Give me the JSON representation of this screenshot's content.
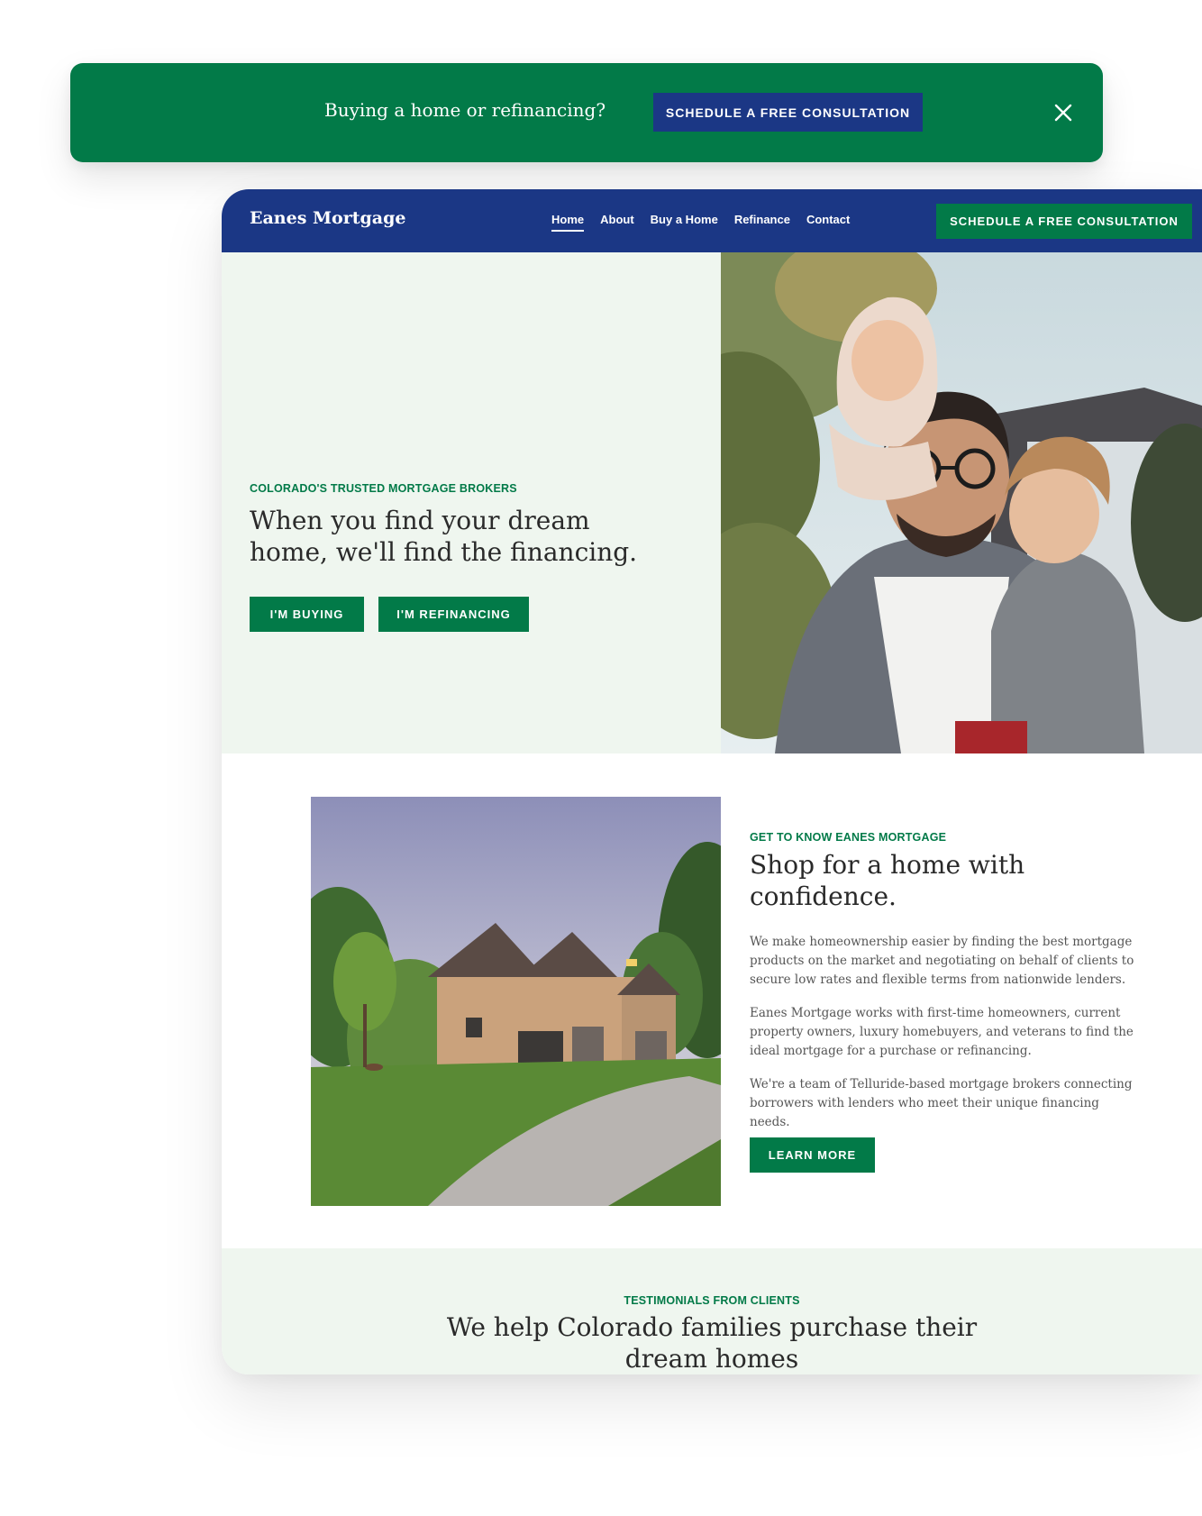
{
  "banner": {
    "text": "Buying a home or refinancing?",
    "button_label": "SCHEDULE A FREE CONSULTATION",
    "close_icon": "close-icon"
  },
  "nav": {
    "logo": "Eanes Mortgage",
    "links": [
      "Home",
      "About",
      "Buy a Home",
      "Refinance",
      "Contact"
    ],
    "active_link": "Home",
    "cta_label": "SCHEDULE A FREE CONSULTATION"
  },
  "hero": {
    "eyebrow": "COLORADO'S TRUSTED MORTGAGE BROKERS",
    "title": "When you find your dream home, we'll find the financing.",
    "buttons": [
      "I'M BUYING",
      "I'M REFINANCING"
    ]
  },
  "about": {
    "eyebrow": "GET TO KNOW EANES MORTGAGE",
    "title": "Shop for a home with confidence.",
    "paragraphs": [
      "We make homeownership easier by finding the best mortgage products on the market and negotiating on behalf of clients to secure low rates and flexible terms from nationwide lenders.",
      "Eanes Mortgage works with first-time homeowners, current property owners, luxury homebuyers, and veterans to find the ideal mortgage for a purchase or refinancing.",
      "We're a team of Telluride-based mortgage brokers connecting borrowers with lenders who meet their unique financing needs."
    ],
    "button_label": "LEARN MORE"
  },
  "testimonials": {
    "eyebrow": "TESTIMONIALS FROM CLIENTS",
    "title": "We help Colorado families purchase their dream homes"
  },
  "colors": {
    "brand_green": "#027a48",
    "brand_navy": "#1b3785",
    "hero_bg": "#eff6ef"
  }
}
